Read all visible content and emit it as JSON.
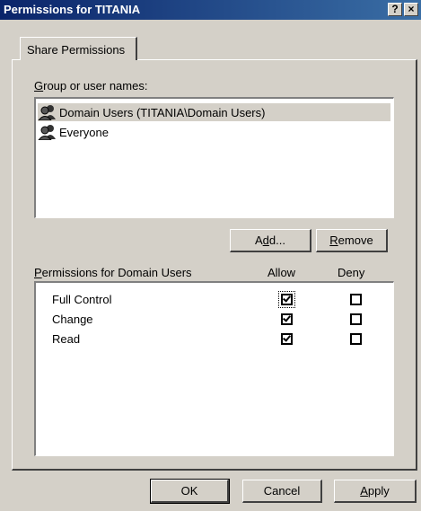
{
  "window": {
    "title": "Permissions for TITANIA",
    "help_button": "?",
    "close_button": "×"
  },
  "tab": {
    "label": "Share Permissions"
  },
  "group_section": {
    "label_prefix": "",
    "label_underlined": "G",
    "label_rest": "roup or user names:",
    "users": [
      {
        "name": "Domain Users (TITANIA\\Domain Users)",
        "selected": true,
        "icon": "users-group-icon"
      },
      {
        "name": "Everyone",
        "selected": false,
        "icon": "users-group-icon"
      }
    ],
    "add_button": {
      "pre": "A",
      "underlined": "d",
      "post": "d..."
    },
    "remove_button": {
      "pre": "",
      "underlined": "R",
      "post": "emove"
    }
  },
  "permissions_section": {
    "label_prefix": "",
    "label_underlined": "P",
    "label_rest": "ermissions for Domain Users",
    "allow_header": "Allow",
    "deny_header": "Deny",
    "rows": [
      {
        "name": "Full Control",
        "allow": true,
        "deny": false
      },
      {
        "name": "Change",
        "allow": true,
        "deny": false
      },
      {
        "name": "Read",
        "allow": true,
        "deny": false
      }
    ]
  },
  "footer": {
    "ok_label": "OK",
    "cancel_label": "Cancel",
    "apply_pre": "",
    "apply_underlined": "A",
    "apply_post": "pply"
  }
}
